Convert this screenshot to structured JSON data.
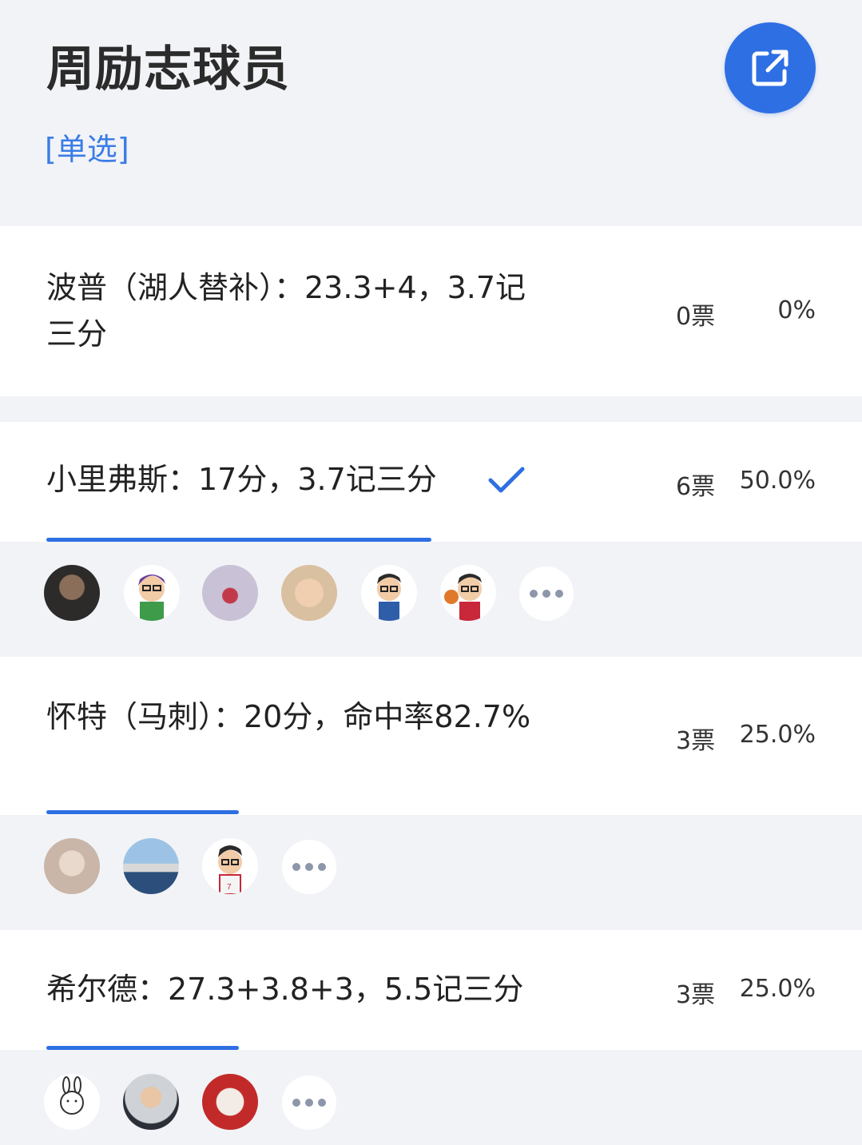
{
  "poll": {
    "title": "周励志球员",
    "type_label": "[单选]"
  },
  "options": [
    {
      "text_line1": "波普（湖人替补）：23.3+4，3.7记",
      "text_line2": "三分",
      "votes": "0票",
      "percent": "0%",
      "progress": 0.0,
      "checked": false
    },
    {
      "text_line1": "小里弗斯：17分，3.7记三分",
      "votes": "6票",
      "percent": "50.0%",
      "progress": 0.5,
      "checked": true
    },
    {
      "text_line1": "怀特（马刺）：20分，命中率82.7%",
      "votes": "3票",
      "percent": "25.0%",
      "progress": 0.25,
      "checked": false
    },
    {
      "text_line1": "希尔德：27.3+3.8+3，5.5记三分",
      "votes": "3票",
      "percent": "25.0%",
      "progress": 0.25,
      "checked": false
    }
  ],
  "colors": {
    "accent": "#2e6fe3",
    "background": "#f2f3f7",
    "card": "#ffffff"
  },
  "icons": {
    "share": "external-link-icon",
    "check": "checkmark-icon",
    "more": "more-dots-icon"
  }
}
